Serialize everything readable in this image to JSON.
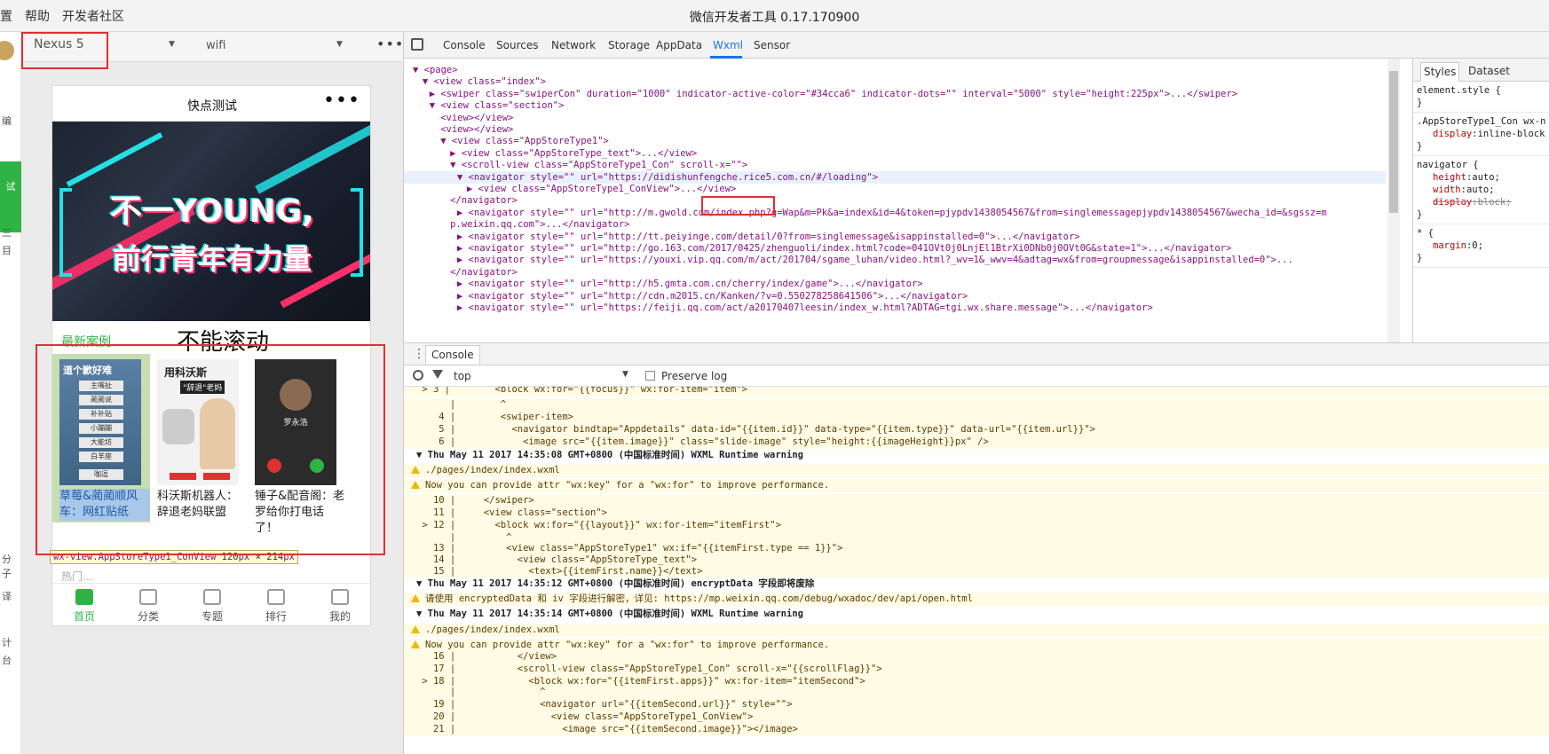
{
  "topbar": {
    "menu": [
      "置",
      "帮助",
      "开发者社区"
    ],
    "title": "微信开发者工具 0.17.170900"
  },
  "leftstrip": {
    "labels": [
      "编",
      "试",
      "三",
      "目",
      "分",
      "子",
      "译",
      "计",
      "台"
    ]
  },
  "simulator": {
    "device": "Nexus 5",
    "network": "wifi",
    "more": "•••",
    "phone": {
      "title": "快点测试",
      "menu": "•••",
      "banner": {
        "line1": "不一YOUNG,",
        "line2": "前行青年有力量"
      },
      "section_title": "最新案例",
      "annotation": "不能滚动",
      "apps": [
        {
          "name": "草莓&蔺蔺顺风车：网红贴纸",
          "cover_title": "道个歉好难",
          "cover_labels": [
            "主嘴扯",
            "蔺蔺说",
            "补补贴",
            "小蹦蹦",
            "大能坊",
            "白羊座",
            "咖逗"
          ]
        },
        {
          "name": "科沃斯机器人：辞退老妈联盟",
          "cover_title": "用科沃斯",
          "cover_sub": "\"辞退\"老妈"
        },
        {
          "name": "锤子&配音阁：老罗给你打电话了！",
          "cover_person": "罗永浩"
        }
      ],
      "under_text": "热门…",
      "tooltip": {
        "tag": "wx-view.AppStoreType1_ConView",
        "w": "120",
        "h": "214",
        "unit": "px",
        "sep": "×"
      },
      "tabs": [
        "首页",
        "分类",
        "专题",
        "排行",
        "我的"
      ]
    }
  },
  "devtools": {
    "tabs": [
      "Console",
      "Sources",
      "Network",
      "Storage",
      "AppData",
      "Wxml",
      "Sensor"
    ],
    "selected_tab": "Wxml",
    "styles_tabs": [
      "Styles",
      "Dataset"
    ],
    "wxml_lines": [
      "▼ <page>",
      "▼ <view class=\"index\">",
      "▶ <swiper class=\"swiperCon\" duration=\"1000\" indicator-active-color=\"#34cca6\" indicator-dots=\"\" interval=\"5000\" style=\"height:225px\">...</swiper>",
      "▼ <view class=\"section\">",
      "<view></view>",
      "<view></view>",
      "▼ <view class=\"AppStoreType1\">",
      "▶ <view class=\"AppStoreType_text\">...</view>",
      "▼ <scroll-view class=\"AppStoreType1_Con\" scroll-x=\"\">",
      "▼ <navigator style=\"\" url=\"https://didishunfengche.rice5.com.cn/#/loading\">",
      "▶ <view class=\"AppStoreType1_ConView\">...</view>",
      "</navigator>",
      "▶ <navigator style=\"\" url=\"http://m.gwold.com/index.php?g=Wap&m=Pk&a=index&id=4&token=pjypdv1438054567&from=singlemessagepjypdv1438054567&wecha_id=&sgssz=m",
      "p.weixin.qq.com\">...</navigator>",
      "▶ <navigator style=\"\" url=\"http://tt.peiyinge.com/detail/0?from=singlemessage&isappinstalled=0\">...</navigator>",
      "▶ <navigator style=\"\" url=\"http://go.163.com/2017/0425/zhenguoli/index.html?code=041OVt0j0LnjEl1BtrXi0DNb0j0OVt0G&state=1\">...</navigator>",
      "▶ <navigator style=\"\" url=\"https://youxi.vip.qq.com/m/act/201704/sgame_luhan/video.html?_wv=1&_wwv=4&adtag=wx&from=groupmessage&isappinstalled=0\">...",
      "</navigator>",
      "▶ <navigator style=\"\" url=\"http://h5.gmta.com.cn/cherry/index/game\">...</navigator>",
      "▶ <navigator style=\"\" url=\"http://cdn.m2015.cn/Kanken/?v=0.550278258641506\">...</navigator>",
      "▶ <navigator style=\"\" url=\"https://feiji.qq.com/act/a20170407leesin/index_w.html?ADTAG=tgi.wx.share.message\">...</navigator>"
    ],
    "styles_rules": [
      {
        "sel": "element.style {",
        "props": [],
        "close": "}"
      },
      {
        "sel": ".AppStoreType1_Con wx-n",
        "props": [
          [
            "display",
            "inline-block"
          ]
        ],
        "close": "}"
      },
      {
        "sel": "navigator {",
        "props": [
          [
            "height",
            "auto;"
          ],
          [
            "width",
            "auto;"
          ],
          [
            "display",
            "block;"
          ]
        ],
        "close": "}"
      },
      {
        "sel": "* {",
        "props": [
          [
            "margin",
            "0;"
          ]
        ],
        "close": "}"
      }
    ],
    "console": {
      "tab": "Console",
      "context": "top",
      "preserve_log": "Preserve log",
      "lines": [
        {
          "t": "code",
          "text": " > 3 |        <block wx:for=\"{{focus}}\" wx:for-item=\"item\">"
        },
        {
          "t": "code",
          "text": "      |        ^"
        },
        {
          "t": "code",
          "text": "    4 |        <swiper-item>"
        },
        {
          "t": "code",
          "text": "    5 |          <navigator bindtap=\"Appdetails\" data-id=\"{{item.id}}\" data-type=\"{{item.type}}\" data-url=\"{{item.url}}\">"
        },
        {
          "t": "code",
          "text": "    6 |            <image src=\"{{item.image}}\" class=\"slide-image\" style=\"height:{{imageHeight}}px\" />"
        },
        {
          "t": "head",
          "text": "▼ Thu May 11 2017 14:35:08 GMT+0800 (中国标准时间) WXML Runtime warning"
        },
        {
          "t": "warn",
          "text": "./pages/index/index.wxml"
        },
        {
          "t": "warn",
          "text": "Now you can provide attr \"wx:key\" for a \"wx:for\" to improve performance."
        },
        {
          "t": "code",
          "text": "   10 |     </swiper>"
        },
        {
          "t": "code",
          "text": "   11 |     <view class=\"section\">"
        },
        {
          "t": "code",
          "text": " > 12 |       <block wx:for=\"{{layout}}\" wx:for-item=\"itemFirst\">"
        },
        {
          "t": "code",
          "text": "      |         ^"
        },
        {
          "t": "code",
          "text": "   13 |         <view class=\"AppStoreType1\" wx:if=\"{{itemFirst.type == 1}}\">"
        },
        {
          "t": "code",
          "text": "   14 |           <view class=\"AppStoreType_text\">"
        },
        {
          "t": "code",
          "text": "   15 |             <text>{{itemFirst.name}}</text>"
        },
        {
          "t": "head",
          "text": "▼ Thu May 11 2017 14:35:12 GMT+0800 (中国标准时间) encryptData 字段即将废除"
        },
        {
          "t": "warn",
          "text": "请使用 encryptedData 和 iv 字段进行解密，详见: https://mp.weixin.qq.com/debug/wxadoc/dev/api/open.html"
        },
        {
          "t": "head",
          "text": "▼ Thu May 11 2017 14:35:14 GMT+0800 (中国标准时间) WXML Runtime warning"
        },
        {
          "t": "warn",
          "text": "./pages/index/index.wxml"
        },
        {
          "t": "warn",
          "text": "Now you can provide attr \"wx:key\" for a \"wx:for\" to improve performance."
        },
        {
          "t": "code",
          "text": "   16 |           </view>"
        },
        {
          "t": "code",
          "text": "   17 |           <scroll-view class=\"AppStoreType1_Con\" scroll-x=\"{{scrollFlag}}\">"
        },
        {
          "t": "code",
          "text": " > 18 |             <block wx:for=\"{{itemFirst.apps}}\" wx:for-item=\"itemSecond\">"
        },
        {
          "t": "code",
          "text": "      |               ^"
        },
        {
          "t": "code",
          "text": "   19 |               <navigator url=\"{{itemSecond.url}}\" style=\"\">"
        },
        {
          "t": "code",
          "text": "   20 |                 <view class=\"AppStoreType1_ConView\">"
        },
        {
          "t": "code",
          "text": "   21 |                   <image src=\"{{itemSecond.image}}\"></image>"
        }
      ]
    }
  },
  "colors": {
    "accent_green": "#2fb344",
    "annotation_red": "#e03030",
    "devtools_blue": "#1a73e8"
  }
}
